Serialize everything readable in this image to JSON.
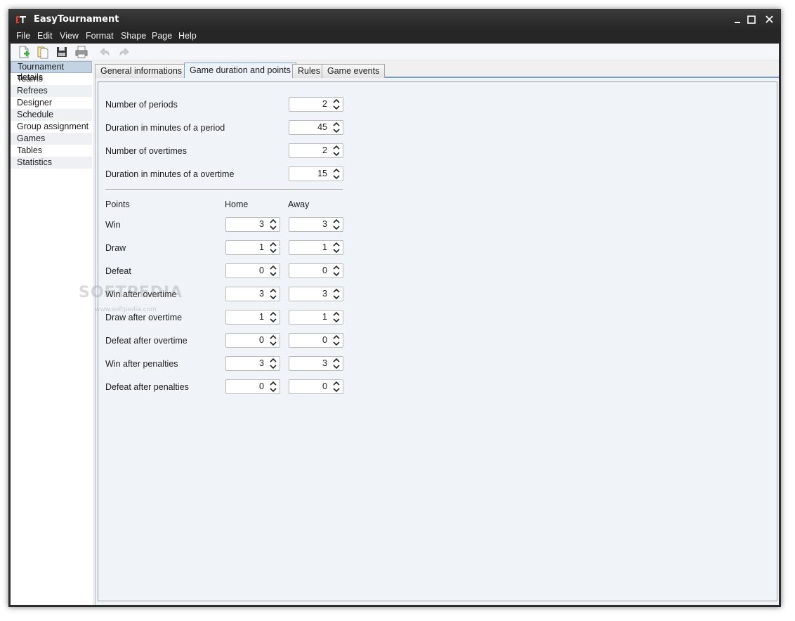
{
  "window": {
    "title": "EasyTournament"
  },
  "menu": [
    "File",
    "Edit",
    "View",
    "Format",
    "Shape",
    "Page",
    "Help"
  ],
  "toolbar": {
    "buttons": [
      {
        "name": "new-file-icon"
      },
      {
        "name": "open-file-icon"
      },
      {
        "name": "save-icon"
      },
      {
        "name": "print-icon"
      },
      {
        "name": "undo-icon"
      },
      {
        "name": "redo-icon"
      }
    ]
  },
  "sidebar": {
    "items": [
      {
        "label": "Tournament details"
      },
      {
        "label": "Teams"
      },
      {
        "label": "Refrees"
      },
      {
        "label": "Designer"
      },
      {
        "label": "Schedule"
      },
      {
        "label": "Group assignment"
      },
      {
        "label": "Games"
      },
      {
        "label": "Tables"
      },
      {
        "label": "Statistics"
      }
    ],
    "selected": "Tournament details"
  },
  "tabs": [
    {
      "label": "General informations"
    },
    {
      "label": "Game duration and points"
    },
    {
      "label": "Rules"
    },
    {
      "label": "Game events"
    }
  ],
  "active_tab": "Game duration and points",
  "duration": {
    "fields": [
      {
        "label": "Number of periods",
        "value": "2"
      },
      {
        "label": "Duration in minutes of a period",
        "value": "45"
      },
      {
        "label": "Number of overtimes",
        "value": "2"
      },
      {
        "label": "Duration in minutes of a overtime",
        "value": "15"
      }
    ]
  },
  "points": {
    "header": {
      "label": "Points",
      "home": "Home",
      "away": "Away"
    },
    "rows": [
      {
        "label": "Win",
        "home": "3",
        "away": "3"
      },
      {
        "label": "Draw",
        "home": "1",
        "away": "1"
      },
      {
        "label": "Defeat",
        "home": "0",
        "away": "0"
      },
      {
        "label": "Win after overtime",
        "home": "3",
        "away": "3"
      },
      {
        "label": "Draw after overtime",
        "home": "1",
        "away": "1"
      },
      {
        "label": "Defeat after overtime",
        "home": "0",
        "away": "0"
      },
      {
        "label": "Win after penalties",
        "home": "3",
        "away": "3"
      },
      {
        "label": "Defeat after penalties",
        "home": "0",
        "away": "0"
      }
    ]
  },
  "watermark": {
    "text": "SOFTPEDIA",
    "url": "www.softpedia.com"
  },
  "colors": {
    "titlebar": "#2b2b2b",
    "sidebar_active": "#c3d3e3",
    "tab_active_border": "#7a9cc0",
    "panel_bg": "#f0f4f8"
  }
}
